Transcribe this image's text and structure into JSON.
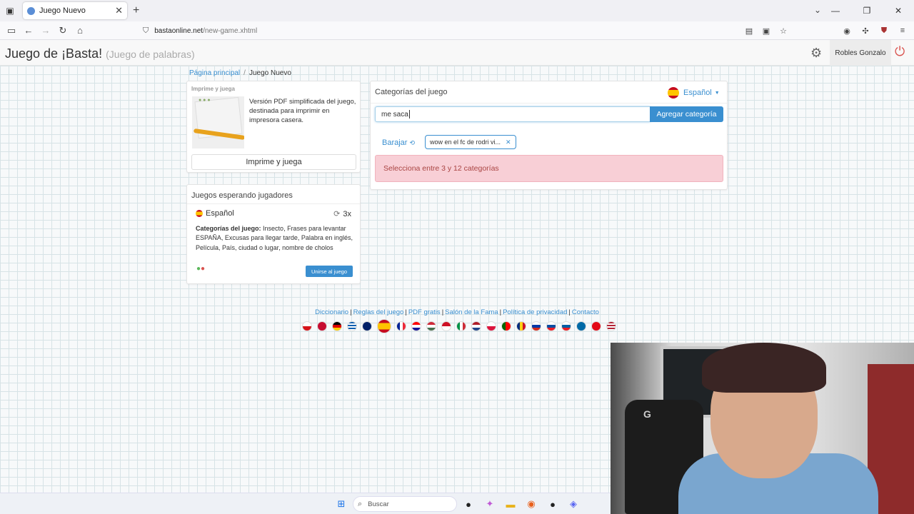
{
  "browser": {
    "tab_title": "Juego Nuevo",
    "url_domain": "bastaonline.net",
    "url_path": "/new-game.xhtml"
  },
  "header": {
    "brand_title": "Juego de ¡Basta!",
    "brand_subtitle": "(Juego de palabras)",
    "user_name": "Robles Gonzalo"
  },
  "breadcrumb": {
    "home": "Página principal",
    "current": "Juego Nuevo"
  },
  "print_card": {
    "label": "Imprime y juega",
    "description": "Versión PDF simplificada del juego, destinada para imprimir en impresora casera.",
    "button": "Imprime y juega"
  },
  "waiting_card": {
    "title": "Juegos esperando jugadores",
    "language": "Español",
    "rounds": "3x",
    "categories_label": "Categorías del juego:",
    "categories_text": "Insecto, Frases para levantar ESPAÑA, Excusas para llegar tarde, Palabra en inglés, Película, País, ciudad o lugar, nombre de cholos",
    "join_button": "Unirse al juego"
  },
  "categories_card": {
    "title": "Categorías del juego",
    "language": "Español",
    "input_value": "me saca",
    "add_button": "Agregar categoría",
    "shuffle_label": "Barajar",
    "tag": "wow en el fc de rodri vi...",
    "alert": "Selecciona entre 3 y 12 categorías"
  },
  "footer": {
    "links": [
      "Diccionario",
      "Reglas del juego",
      "PDF gratis",
      "Salón de la Fama",
      "Política de privacidad",
      "Contacto"
    ]
  },
  "taskbar": {
    "search_placeholder": "Buscar"
  },
  "colors": {
    "accent": "#3a8fd0",
    "alert_bg": "#f8cfd6",
    "alert_text": "#a94442"
  }
}
